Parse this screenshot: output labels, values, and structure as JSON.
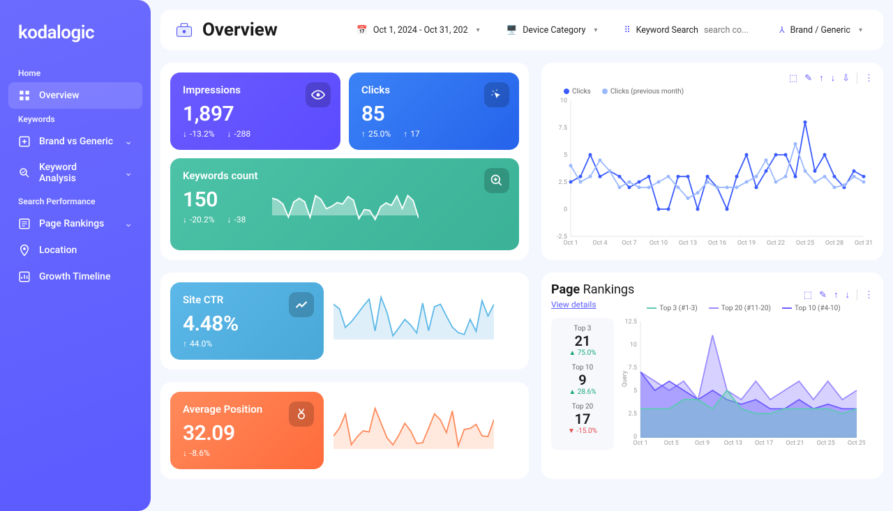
{
  "brand": "kodalogic",
  "sidebar": {
    "sections": [
      {
        "label": "Home",
        "items": [
          {
            "icon": "grid-icon",
            "label": "Overview",
            "active": true
          }
        ]
      },
      {
        "label": "Keywords",
        "items": [
          {
            "icon": "plus-square-icon",
            "label": "Brand vs Generic",
            "expandable": true
          },
          {
            "icon": "analysis-icon",
            "label": "Keyword Analysis",
            "expandable": true
          }
        ]
      },
      {
        "label": "Search Performance",
        "items": [
          {
            "icon": "list-icon",
            "label": "Page Rankings",
            "expandable": true
          },
          {
            "icon": "pin-icon",
            "label": "Location"
          },
          {
            "icon": "chart-icon",
            "label": "Growth Timeline"
          }
        ]
      }
    ]
  },
  "header": {
    "title": "Overview",
    "date_range": "Oct 1, 2024 - Oct 31, 202",
    "device_label": "Device Category",
    "keyword_label": "Keyword Search",
    "keyword_placeholder": "search co...",
    "brand_label": "Brand / Generic"
  },
  "cards": {
    "impressions": {
      "label": "Impressions",
      "value": "1,897",
      "pct": "-13.2%",
      "pct_dir": "down",
      "diff": "-288",
      "diff_dir": "down"
    },
    "clicks": {
      "label": "Clicks",
      "value": "85",
      "pct": "25.0%",
      "pct_dir": "up",
      "diff": "17",
      "diff_dir": "up"
    },
    "keywords": {
      "label": "Keywords count",
      "value": "150",
      "pct": "-20.2%",
      "pct_dir": "down",
      "diff": "-38",
      "diff_dir": "down"
    },
    "ctr": {
      "label": "Site CTR",
      "value": "4.48%",
      "pct": "44.0%",
      "pct_dir": "up"
    },
    "position": {
      "label": "Average Position",
      "value": "32.09",
      "pct": "-8.6%",
      "pct_dir": "down"
    }
  },
  "clicks_chart": {
    "legend": [
      "Clicks",
      "Clicks (previous month)"
    ],
    "colors": [
      "#3b5bff",
      "#9bb8ff"
    ],
    "ylim": [
      -2.5,
      10
    ],
    "yticks": [
      -2.5,
      0,
      2.5,
      5,
      7.5,
      10
    ],
    "x_labels": [
      "Oct 1",
      "Oct 4",
      "Oct 7",
      "Oct 10",
      "Oct 13",
      "Oct 16",
      "Oct 19",
      "Oct 22",
      "Oct 25",
      "Oct 28",
      "Oct 31"
    ],
    "series": [
      {
        "name": "Clicks",
        "values": [
          2.5,
          3,
          5,
          3,
          3.5,
          3,
          2,
          2.5,
          3,
          0,
          0,
          3,
          3,
          0,
          3,
          2,
          0,
          3,
          5,
          2,
          3.5,
          5,
          5,
          3,
          8,
          3.5,
          5,
          3,
          2,
          3.5,
          3
        ]
      },
      {
        "name": "Clicks (previous month)",
        "values": [
          4,
          2.5,
          3,
          4.5,
          3.5,
          2,
          2.5,
          2,
          2,
          2.5,
          3,
          2,
          1,
          1.5,
          2.5,
          2,
          2,
          2,
          2.5,
          3,
          4.5,
          2.5,
          3,
          6,
          3.5,
          2.5,
          3,
          2,
          2.2,
          3,
          2.5
        ]
      }
    ]
  },
  "rankings": {
    "title_bold": "Page",
    "title_rest": "Rankings",
    "link": "View details",
    "legend": [
      "Top 3 (#1-3)",
      "Top 20 (#11-20)",
      "Top 10 (#4-10)"
    ],
    "colors": [
      "#5cc9b4",
      "#9a8cff",
      "#6b5bff"
    ],
    "items": [
      {
        "label": "Top 3",
        "value": "21",
        "pct": "75.0%",
        "dir": "up"
      },
      {
        "label": "Top 10",
        "value": "9",
        "pct": "28.6%",
        "dir": "up"
      },
      {
        "label": "Top 20",
        "value": "17",
        "pct": "-15.0%",
        "dir": "down"
      }
    ],
    "ylabel": "Query",
    "yticks": [
      0,
      2.5,
      5,
      7.5,
      10,
      12.5
    ],
    "x_labels": [
      "Oct 1",
      "Oct 5",
      "Oct 9",
      "Oct 13",
      "Oct 17",
      "Oct 21",
      "Oct 25",
      "Oct 29"
    ],
    "series": [
      {
        "name": "Top 3",
        "values": [
          3,
          3,
          3,
          4,
          4,
          3,
          5,
          3,
          2.5,
          2.5,
          3,
          3,
          3,
          3,
          2.5,
          3
        ]
      },
      {
        "name": "Top 20",
        "values": [
          7,
          6,
          5,
          6,
          4,
          11,
          5,
          4,
          6,
          4,
          5,
          6,
          4,
          6,
          4,
          5
        ]
      },
      {
        "name": "Top 10",
        "values": [
          7,
          5,
          6,
          5,
          4,
          5,
          4,
          3.5,
          4,
          3,
          3,
          4,
          3,
          3.5,
          3,
          3
        ]
      }
    ]
  },
  "chart_data": [
    {
      "type": "line",
      "title": "Clicks vs previous month",
      "x": [
        "Oct 1",
        "Oct 2",
        "Oct 3",
        "Oct 4",
        "Oct 5",
        "Oct 6",
        "Oct 7",
        "Oct 8",
        "Oct 9",
        "Oct 10",
        "Oct 11",
        "Oct 12",
        "Oct 13",
        "Oct 14",
        "Oct 15",
        "Oct 16",
        "Oct 17",
        "Oct 18",
        "Oct 19",
        "Oct 20",
        "Oct 21",
        "Oct 22",
        "Oct 23",
        "Oct 24",
        "Oct 25",
        "Oct 26",
        "Oct 27",
        "Oct 28",
        "Oct 29",
        "Oct 30",
        "Oct 31"
      ],
      "series": [
        {
          "name": "Clicks",
          "values": [
            2.5,
            3,
            5,
            3,
            3.5,
            3,
            2,
            2.5,
            3,
            0,
            0,
            3,
            3,
            0,
            3,
            2,
            0,
            3,
            5,
            2,
            3.5,
            5,
            5,
            3,
            8,
            3.5,
            5,
            3,
            2,
            3.5,
            3
          ]
        },
        {
          "name": "Clicks (previous month)",
          "values": [
            4,
            2.5,
            3,
            4.5,
            3.5,
            2,
            2.5,
            2,
            2,
            2.5,
            3,
            2,
            1,
            1.5,
            2.5,
            2,
            2,
            2,
            2.5,
            3,
            4.5,
            2.5,
            3,
            6,
            3.5,
            2.5,
            3,
            2,
            2.2,
            3,
            2.5
          ]
        }
      ],
      "ylim": [
        -2.5,
        10
      ]
    },
    {
      "type": "area",
      "title": "Page Rankings",
      "x": [
        "Oct 1",
        "Oct 3",
        "Oct 5",
        "Oct 7",
        "Oct 9",
        "Oct 11",
        "Oct 13",
        "Oct 15",
        "Oct 17",
        "Oct 19",
        "Oct 21",
        "Oct 23",
        "Oct 25",
        "Oct 27",
        "Oct 29",
        "Oct 31"
      ],
      "series": [
        {
          "name": "Top 3 (#1-3)",
          "values": [
            3,
            3,
            3,
            4,
            4,
            3,
            5,
            3,
            2.5,
            2.5,
            3,
            3,
            3,
            3,
            2.5,
            3
          ]
        },
        {
          "name": "Top 20 (#11-20)",
          "values": [
            7,
            6,
            5,
            6,
            4,
            11,
            5,
            4,
            6,
            4,
            5,
            6,
            4,
            6,
            4,
            5
          ]
        },
        {
          "name": "Top 10 (#4-10)",
          "values": [
            7,
            5,
            6,
            5,
            4,
            5,
            4,
            3.5,
            4,
            3,
            3,
            4,
            3,
            3.5,
            3,
            3
          ]
        }
      ],
      "ylabel": "Query",
      "ylim": [
        0,
        12.5
      ]
    }
  ]
}
